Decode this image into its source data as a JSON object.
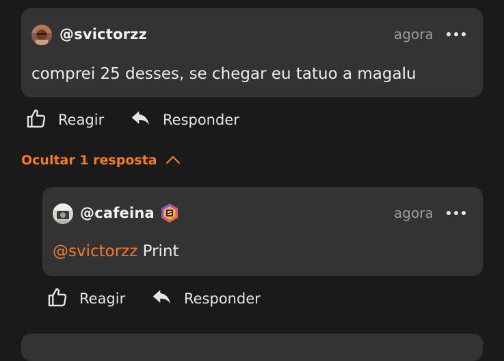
{
  "comment": {
    "username": "@svictorzz",
    "time": "agora",
    "text": "comprei 25 desses, se chegar eu tatuo a magalu",
    "actions": {
      "react": "Reagir",
      "reply": "Responder"
    }
  },
  "replies_toggle": {
    "label": "Ocultar 1 resposta"
  },
  "reply": {
    "username": "@cafeina",
    "time": "agora",
    "mention": "@svictorzz",
    "text": " Print",
    "actions": {
      "react": "Reagir",
      "reply": "Responder"
    }
  },
  "colors": {
    "background": "#1a1a1a",
    "card": "#333333",
    "accent": "#f47b20",
    "muted": "#9b9b9b"
  },
  "icons": {
    "more": "more-horizontal-icon",
    "react": "thumbs-up-icon",
    "reply": "reply-arrow-icon",
    "toggle": "chevron-up-icon",
    "badge": "level-badge-icon"
  }
}
